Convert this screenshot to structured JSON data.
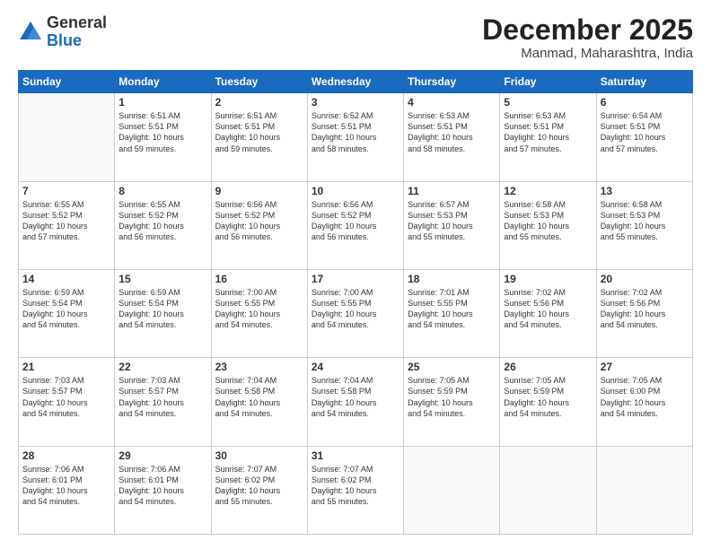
{
  "logo": {
    "general": "General",
    "blue": "Blue"
  },
  "header": {
    "month": "December 2025",
    "location": "Manmad, Maharashtra, India"
  },
  "days": [
    "Sunday",
    "Monday",
    "Tuesday",
    "Wednesday",
    "Thursday",
    "Friday",
    "Saturday"
  ],
  "weeks": [
    [
      {
        "day": "",
        "info": ""
      },
      {
        "day": "1",
        "info": "Sunrise: 6:51 AM\nSunset: 5:51 PM\nDaylight: 10 hours\nand 59 minutes."
      },
      {
        "day": "2",
        "info": "Sunrise: 6:51 AM\nSunset: 5:51 PM\nDaylight: 10 hours\nand 59 minutes."
      },
      {
        "day": "3",
        "info": "Sunrise: 6:52 AM\nSunset: 5:51 PM\nDaylight: 10 hours\nand 58 minutes."
      },
      {
        "day": "4",
        "info": "Sunrise: 6:53 AM\nSunset: 5:51 PM\nDaylight: 10 hours\nand 58 minutes."
      },
      {
        "day": "5",
        "info": "Sunrise: 6:53 AM\nSunset: 5:51 PM\nDaylight: 10 hours\nand 57 minutes."
      },
      {
        "day": "6",
        "info": "Sunrise: 6:54 AM\nSunset: 5:51 PM\nDaylight: 10 hours\nand 57 minutes."
      }
    ],
    [
      {
        "day": "7",
        "info": "Sunrise: 6:55 AM\nSunset: 5:52 PM\nDaylight: 10 hours\nand 57 minutes."
      },
      {
        "day": "8",
        "info": "Sunrise: 6:55 AM\nSunset: 5:52 PM\nDaylight: 10 hours\nand 56 minutes."
      },
      {
        "day": "9",
        "info": "Sunrise: 6:56 AM\nSunset: 5:52 PM\nDaylight: 10 hours\nand 56 minutes."
      },
      {
        "day": "10",
        "info": "Sunrise: 6:56 AM\nSunset: 5:52 PM\nDaylight: 10 hours\nand 56 minutes."
      },
      {
        "day": "11",
        "info": "Sunrise: 6:57 AM\nSunset: 5:53 PM\nDaylight: 10 hours\nand 55 minutes."
      },
      {
        "day": "12",
        "info": "Sunrise: 6:58 AM\nSunset: 5:53 PM\nDaylight: 10 hours\nand 55 minutes."
      },
      {
        "day": "13",
        "info": "Sunrise: 6:58 AM\nSunset: 5:53 PM\nDaylight: 10 hours\nand 55 minutes."
      }
    ],
    [
      {
        "day": "14",
        "info": "Sunrise: 6:59 AM\nSunset: 5:54 PM\nDaylight: 10 hours\nand 54 minutes."
      },
      {
        "day": "15",
        "info": "Sunrise: 6:59 AM\nSunset: 5:54 PM\nDaylight: 10 hours\nand 54 minutes."
      },
      {
        "day": "16",
        "info": "Sunrise: 7:00 AM\nSunset: 5:55 PM\nDaylight: 10 hours\nand 54 minutes."
      },
      {
        "day": "17",
        "info": "Sunrise: 7:00 AM\nSunset: 5:55 PM\nDaylight: 10 hours\nand 54 minutes."
      },
      {
        "day": "18",
        "info": "Sunrise: 7:01 AM\nSunset: 5:55 PM\nDaylight: 10 hours\nand 54 minutes."
      },
      {
        "day": "19",
        "info": "Sunrise: 7:02 AM\nSunset: 5:56 PM\nDaylight: 10 hours\nand 54 minutes."
      },
      {
        "day": "20",
        "info": "Sunrise: 7:02 AM\nSunset: 5:56 PM\nDaylight: 10 hours\nand 54 minutes."
      }
    ],
    [
      {
        "day": "21",
        "info": "Sunrise: 7:03 AM\nSunset: 5:57 PM\nDaylight: 10 hours\nand 54 minutes."
      },
      {
        "day": "22",
        "info": "Sunrise: 7:03 AM\nSunset: 5:57 PM\nDaylight: 10 hours\nand 54 minutes."
      },
      {
        "day": "23",
        "info": "Sunrise: 7:04 AM\nSunset: 5:58 PM\nDaylight: 10 hours\nand 54 minutes."
      },
      {
        "day": "24",
        "info": "Sunrise: 7:04 AM\nSunset: 5:58 PM\nDaylight: 10 hours\nand 54 minutes."
      },
      {
        "day": "25",
        "info": "Sunrise: 7:05 AM\nSunset: 5:59 PM\nDaylight: 10 hours\nand 54 minutes."
      },
      {
        "day": "26",
        "info": "Sunrise: 7:05 AM\nSunset: 5:59 PM\nDaylight: 10 hours\nand 54 minutes."
      },
      {
        "day": "27",
        "info": "Sunrise: 7:05 AM\nSunset: 6:00 PM\nDaylight: 10 hours\nand 54 minutes."
      }
    ],
    [
      {
        "day": "28",
        "info": "Sunrise: 7:06 AM\nSunset: 6:01 PM\nDaylight: 10 hours\nand 54 minutes."
      },
      {
        "day": "29",
        "info": "Sunrise: 7:06 AM\nSunset: 6:01 PM\nDaylight: 10 hours\nand 54 minutes."
      },
      {
        "day": "30",
        "info": "Sunrise: 7:07 AM\nSunset: 6:02 PM\nDaylight: 10 hours\nand 55 minutes."
      },
      {
        "day": "31",
        "info": "Sunrise: 7:07 AM\nSunset: 6:02 PM\nDaylight: 10 hours\nand 55 minutes."
      },
      {
        "day": "",
        "info": ""
      },
      {
        "day": "",
        "info": ""
      },
      {
        "day": "",
        "info": ""
      }
    ]
  ]
}
